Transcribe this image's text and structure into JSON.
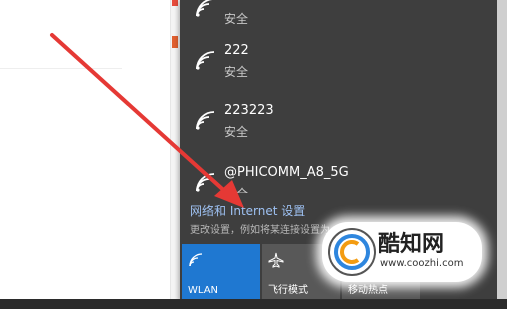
{
  "networks": [
    {
      "name": "",
      "status": "安全"
    },
    {
      "name": "222",
      "status": "安全"
    },
    {
      "name": "223223",
      "status": "安全"
    },
    {
      "name": "@PHICOMM_A8_5G",
      "status": "安全"
    }
  ],
  "settings": {
    "link_label": "网络和 Internet 设置",
    "description": "更改设置，例如将某连接设置为"
  },
  "quick_actions": [
    {
      "label": "WLAN",
      "icon": "wifi-icon",
      "active": true
    },
    {
      "label": "飞行模式",
      "icon": "airplane-icon",
      "active": false
    },
    {
      "label": "移动热点",
      "icon": "hotspot-icon",
      "active": false
    }
  ],
  "watermark": {
    "title": "酷知网",
    "url": "www.coozhi.com"
  },
  "colors": {
    "flyout_bg": "#3e3e3e",
    "accent": "#1f78d1",
    "link": "#9ec1f2",
    "arrow": "#e53935"
  }
}
